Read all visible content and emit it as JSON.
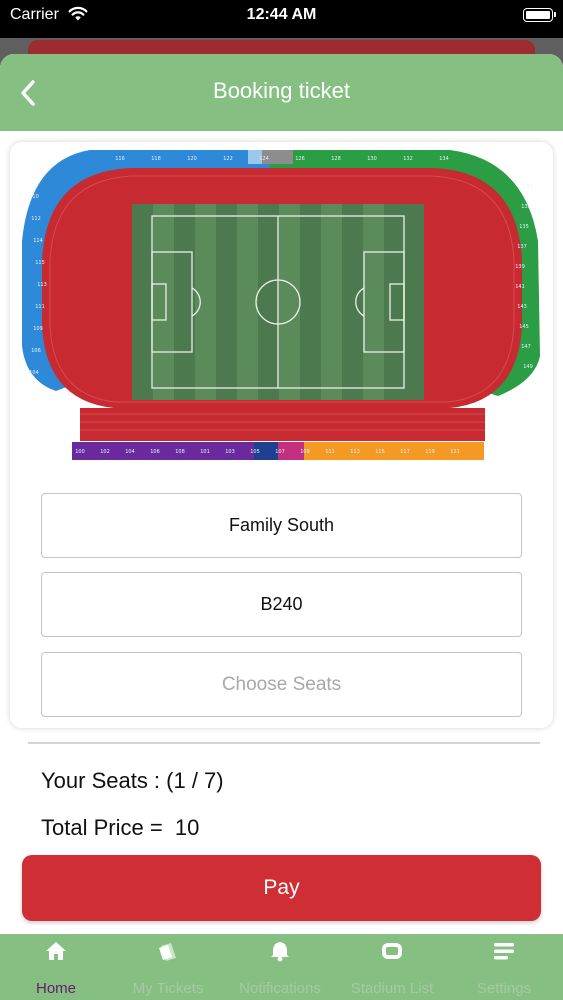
{
  "status": {
    "carrier": "Carrier",
    "time": "12:44 AM"
  },
  "header": {
    "title": "Booking ticket"
  },
  "stadium": {
    "top_sections": [
      "116",
      "118",
      "120",
      "122",
      "124",
      "126",
      "128",
      "130",
      "132",
      "134"
    ],
    "left_sections": [
      "110",
      "112",
      "114",
      "115",
      "113",
      "111",
      "109",
      "106",
      "104"
    ],
    "right_sections": [
      "131",
      "133",
      "135",
      "137",
      "139",
      "141",
      "143",
      "145",
      "147",
      "149"
    ],
    "bottom_sections": [
      "100",
      "102",
      "104",
      "106",
      "108",
      "101",
      "103",
      "105",
      "107",
      "109",
      "111",
      "113",
      "115",
      "117",
      "119",
      "121"
    ],
    "colors": {
      "stand_left": "#2e8ad8",
      "stand_right": "#2a9d45",
      "track": "#c72a30",
      "pitch": "#4c7a4e",
      "bottom_purple": "#6b2a9c",
      "bottom_orange": "#f49a24"
    }
  },
  "form": {
    "stand": "Family South",
    "block": "B240",
    "seats_placeholder": "Choose Seats"
  },
  "summary": {
    "seats": "Your Seats : (1 / 7)",
    "price": "Total Price =  10"
  },
  "pay_button": "Pay",
  "tabs": [
    {
      "label": "Home",
      "icon": "home-icon",
      "active": true
    },
    {
      "label": "My Tickets",
      "icon": "tickets-icon",
      "active": false
    },
    {
      "label": "Notifications",
      "icon": "bell-icon",
      "active": false
    },
    {
      "label": "Stadium List",
      "icon": "stadium-icon",
      "active": false
    },
    {
      "label": "Settings",
      "icon": "menu-icon",
      "active": false
    }
  ],
  "colors": {
    "header_green": "#86bf82",
    "accent_red": "#cf2e35",
    "active_tab": "#6a1a6e"
  }
}
